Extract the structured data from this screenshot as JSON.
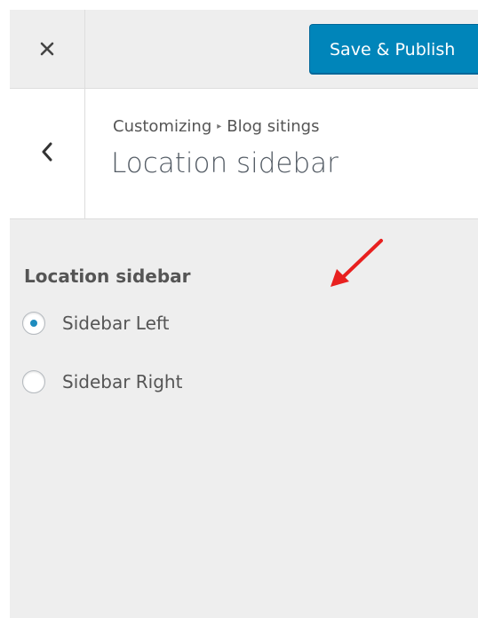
{
  "header": {
    "close_label": "Close",
    "save_label": "Save & Publish"
  },
  "section": {
    "breadcrumb_root": "Customizing",
    "breadcrumb_separator": "▸",
    "breadcrumb_current": "Blog sitings",
    "title": "Location sidebar"
  },
  "control": {
    "title": "Location sidebar",
    "options": [
      {
        "label": "Sidebar Left",
        "checked": true
      },
      {
        "label": "Sidebar Right",
        "checked": false
      }
    ]
  },
  "colors": {
    "accent": "#0085ba",
    "radio_dot": "#1e8cbe",
    "annotation_arrow": "#e8201f",
    "panel_bg": "#eeeeee"
  },
  "icons": {
    "close": "close-icon",
    "back": "chevron-left-icon",
    "annotation": "red-arrow-icon"
  }
}
